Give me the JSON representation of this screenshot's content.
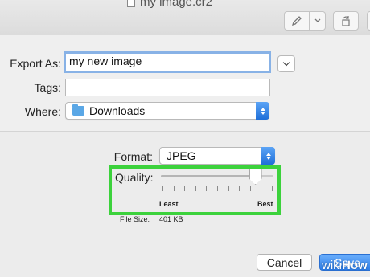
{
  "window": {
    "title": "my image.cr2"
  },
  "export_as": {
    "label": "Export As:",
    "value": "my new image"
  },
  "tags": {
    "label": "Tags:",
    "value": ""
  },
  "where": {
    "label": "Where:",
    "value": "Downloads",
    "icon": "folder-icon"
  },
  "format": {
    "label": "Format:",
    "value": "JPEG"
  },
  "quality": {
    "label": "Quality:",
    "min_label": "Least",
    "max_label": "Best",
    "level": 0.84,
    "highlight_color": "#3cd23c"
  },
  "file_size": {
    "label": "File Size:",
    "value": "401 KB"
  },
  "buttons": {
    "cancel": "Cancel",
    "save": "Save"
  },
  "watermark": {
    "prefix": "wiki",
    "brand": "How"
  },
  "colors": {
    "accent": "#1f6fd8",
    "focus_ring": "#88b2e6"
  }
}
